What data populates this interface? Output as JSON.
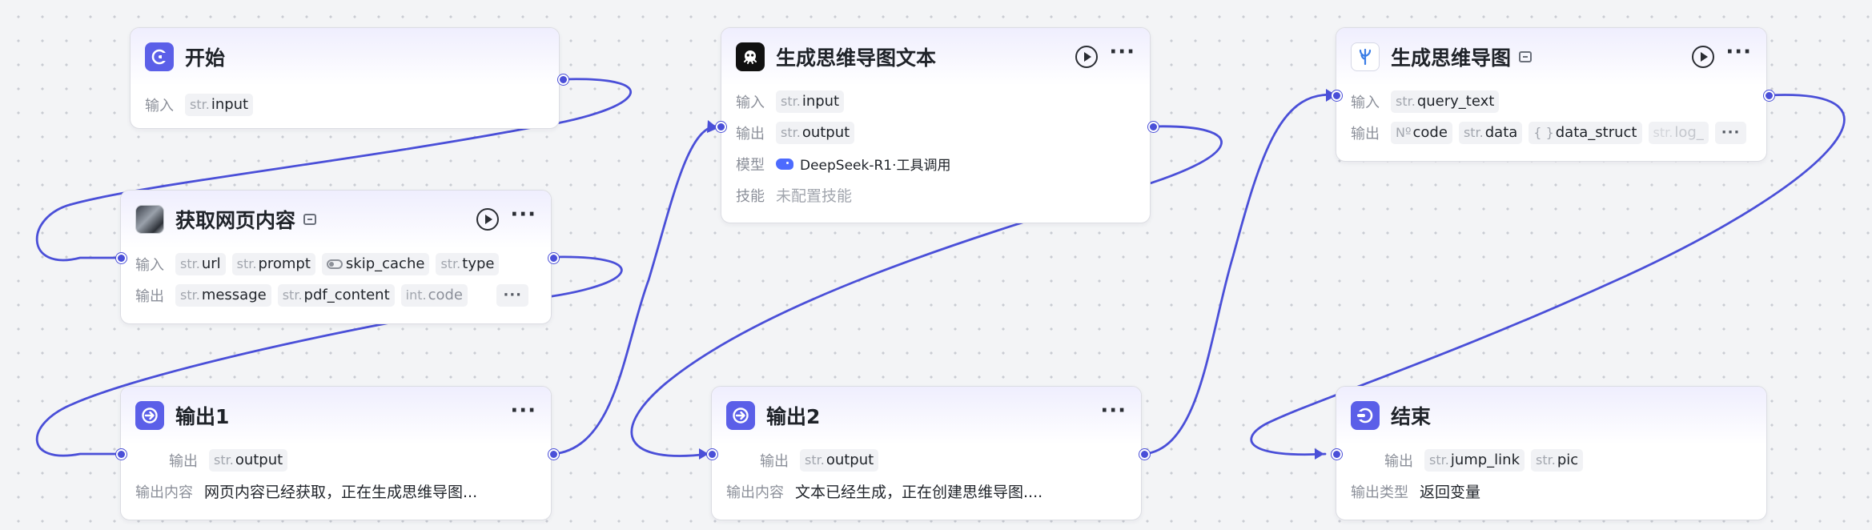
{
  "colors": {
    "accent": "#4a4fd8",
    "edge": "#4a4fd8",
    "canvas": "#f3f4f6"
  },
  "labels": {
    "input": "输入",
    "output": "输出",
    "model": "模型",
    "skills": "技能",
    "output_content": "输出内容",
    "output_type": "输出类型"
  },
  "nodes": {
    "start": {
      "title": "开始",
      "icon": "start-icon",
      "inputs": [
        {
          "type": "str.",
          "name": "input"
        }
      ]
    },
    "fetch": {
      "title": "获取网页内容",
      "icon": "fetch-page-thumbnail",
      "inputs": [
        {
          "type": "str.",
          "name": "url"
        },
        {
          "type": "str.",
          "name": "prompt"
        },
        {
          "type": "toggle",
          "name": "skip_cache"
        },
        {
          "type": "str.",
          "name": "type"
        }
      ],
      "outputs": [
        {
          "type": "str.",
          "name": "message"
        },
        {
          "type": "str.",
          "name": "pdf_content"
        },
        {
          "type": "int.",
          "name": "code"
        }
      ],
      "more": "···"
    },
    "out1": {
      "title": "输出1",
      "icon": "output-icon",
      "outputs": [
        {
          "type": "str.",
          "name": "output"
        }
      ],
      "content": "网页内容已经获取，正在生成思维导图..."
    },
    "gen_text": {
      "title": "生成思维导图文本",
      "icon": "llm-icon",
      "inputs": [
        {
          "type": "str.",
          "name": "input"
        }
      ],
      "outputs": [
        {
          "type": "str.",
          "name": "output"
        }
      ],
      "model": "DeepSeek-R1·工具调用",
      "skills": "未配置技能"
    },
    "out2": {
      "title": "输出2",
      "icon": "output-icon",
      "outputs": [
        {
          "type": "str.",
          "name": "output"
        }
      ],
      "content": "文本已经生成，正在创建思维导图...."
    },
    "mindmap": {
      "title": "生成思维导图",
      "icon": "mindmap-plugin-icon",
      "inputs": [
        {
          "type": "str.",
          "name": "query_text"
        }
      ],
      "outputs": [
        {
          "type": "Nº",
          "name": "code"
        },
        {
          "type": "str.",
          "name": "data"
        },
        {
          "type": "{ }",
          "name": "data_struct"
        },
        {
          "type": "str.",
          "name": "log_"
        }
      ],
      "more": "···"
    },
    "end": {
      "title": "结束",
      "icon": "end-icon",
      "outputs": [
        {
          "type": "str.",
          "name": "jump_link"
        },
        {
          "type": "str.",
          "name": "pic"
        }
      ],
      "output_type": "返回变量"
    }
  }
}
